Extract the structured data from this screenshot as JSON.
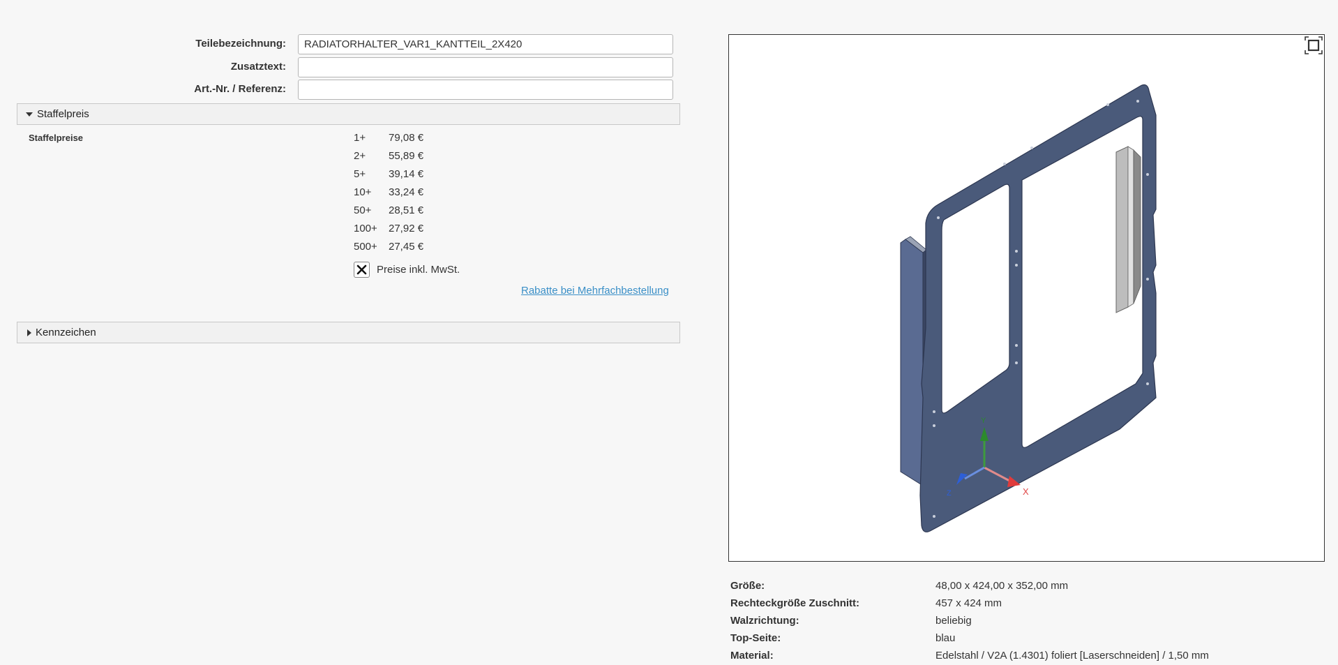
{
  "form": {
    "part_name_label": "Teilebezeichnung:",
    "part_name_value": "RADIATORHALTER_VAR1_KANTTEIL_2X420",
    "extra_text_label": "Zusatztext:",
    "extra_text_value": "",
    "art_nr_label": "Art.-Nr. / Referenz:",
    "art_nr_value": ""
  },
  "staffelpreis": {
    "header": "Staffelpreis",
    "title": "Staffelpreise",
    "rows": [
      {
        "qty": "1+",
        "price": "79,08 €"
      },
      {
        "qty": "2+",
        "price": "55,89 €"
      },
      {
        "qty": "5+",
        "price": "39,14 €"
      },
      {
        "qty": "10+",
        "price": "33,24 €"
      },
      {
        "qty": "50+",
        "price": "28,51 €"
      },
      {
        "qty": "100+",
        "price": "27,92 €"
      },
      {
        "qty": "500+",
        "price": "27,45 €"
      }
    ],
    "vat_checkbox_label": "Preise inkl. MwSt.",
    "vat_checked": true,
    "discount_link": "Rabatte bei Mehrfachbestellung"
  },
  "kennzeichen": {
    "header": "Kennzeichen"
  },
  "viewer": {
    "axis_x": "X",
    "axis_y": "Y",
    "axis_z": "Z",
    "part_color": "#4a5a7a",
    "bracket_color": "#bdbdbd"
  },
  "specs": [
    {
      "label": "Größe:",
      "value": "48,00 x 424,00 x 352,00 mm"
    },
    {
      "label": "Rechteckgröße Zuschnitt:",
      "value": "457 x 424 mm"
    },
    {
      "label": "Walzrichtung:",
      "value": "beliebig"
    },
    {
      "label": "Top-Seite:",
      "value": "blau"
    },
    {
      "label": "Material:",
      "value": "Edelstahl / V2A (1.4301) foliert [Laserschneiden] / 1,50 mm"
    }
  ]
}
